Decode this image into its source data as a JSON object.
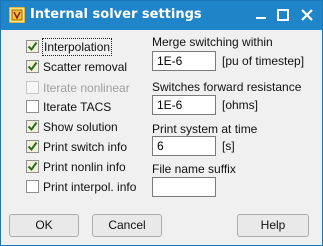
{
  "window": {
    "title": "Internal solver settings",
    "title_color": "#1f84c8",
    "icons": [
      "app-icon",
      "minimize-icon",
      "maximize-icon",
      "close-icon"
    ]
  },
  "checkboxes": [
    {
      "label": "Interpolation",
      "checked": true,
      "enabled": true,
      "focused": true
    },
    {
      "label": "Scatter removal",
      "checked": true,
      "enabled": true
    },
    {
      "label": "Iterate nonlinear",
      "checked": false,
      "enabled": false
    },
    {
      "label": "Iterate TACS",
      "checked": false,
      "enabled": true
    },
    {
      "label": "Show solution",
      "checked": true,
      "enabled": true
    },
    {
      "label": "Print switch info",
      "checked": true,
      "enabled": true
    },
    {
      "label": "Print nonlin info",
      "checked": true,
      "enabled": true
    },
    {
      "label": "Print interpol. info",
      "checked": false,
      "enabled": true
    }
  ],
  "fields": {
    "merge": {
      "label": "Merge switching within",
      "value": "1E-6",
      "unit": "[pu of timestep]"
    },
    "resistance": {
      "label": "Switches forward resistance",
      "value": "1E-6",
      "unit": "[ohms]"
    },
    "print_time": {
      "label": "Print system at time",
      "value": "6",
      "unit": "[s]"
    },
    "suffix": {
      "label": "File name suffix",
      "value": ""
    }
  },
  "buttons": {
    "ok": "OK",
    "cancel": "Cancel",
    "help": "Help"
  }
}
